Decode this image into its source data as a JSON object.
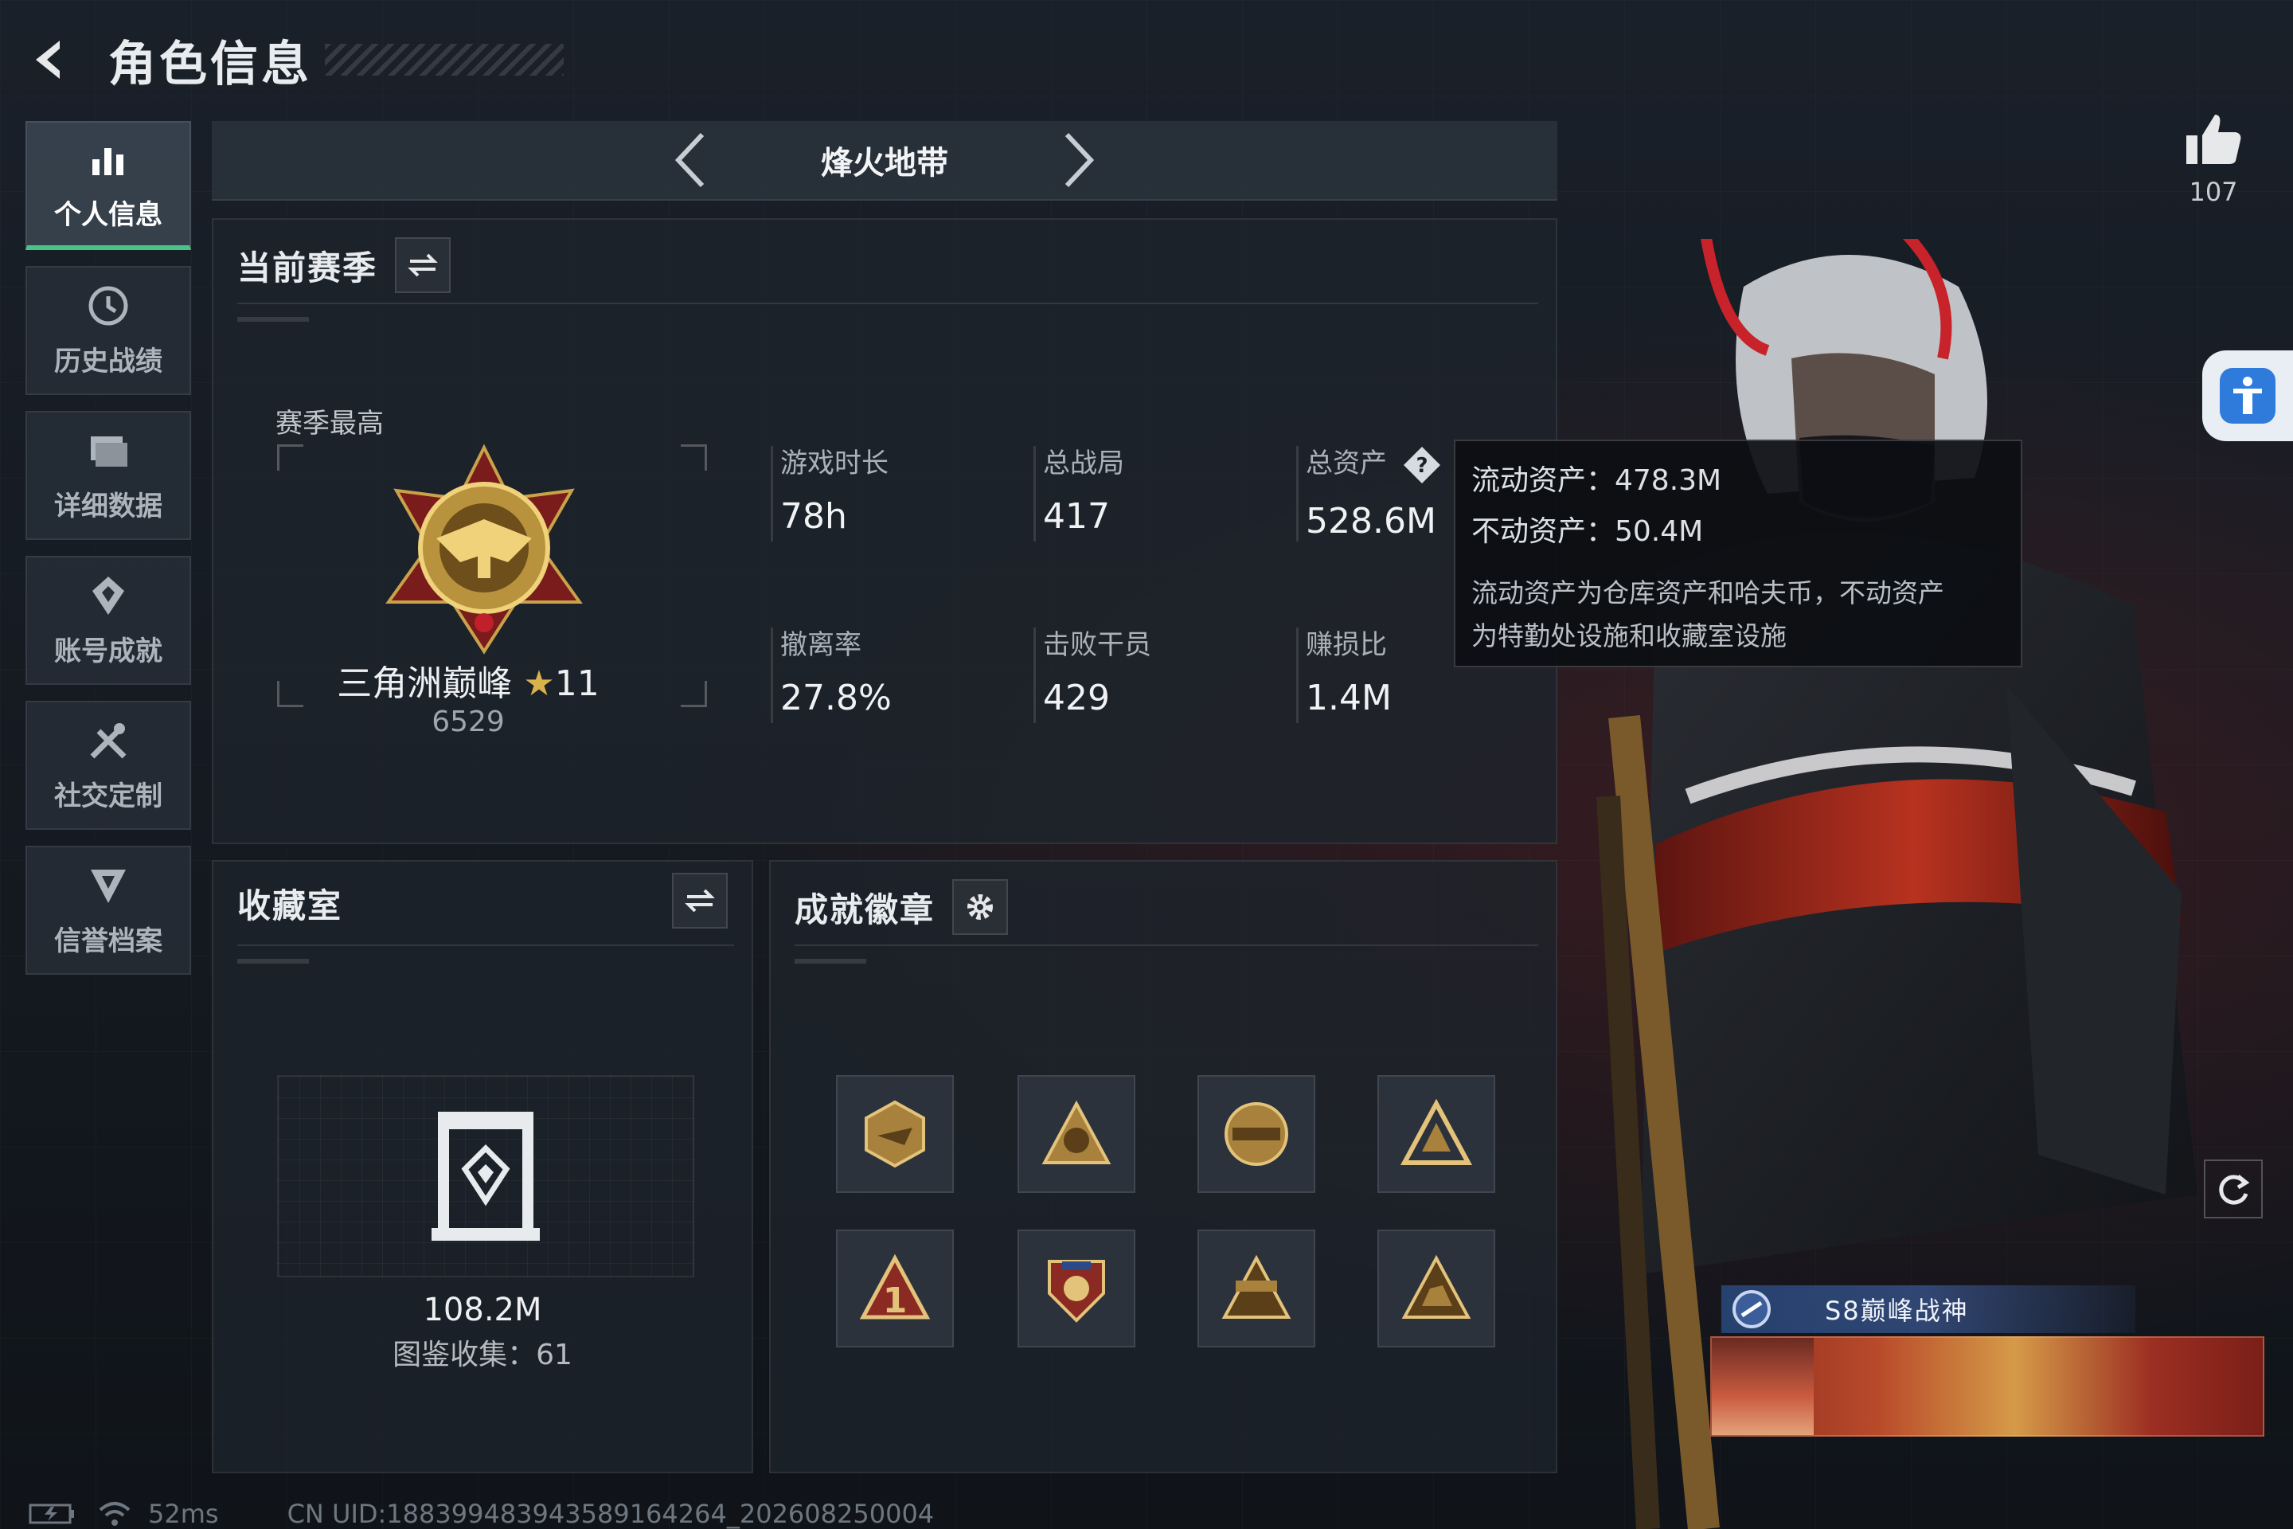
{
  "header": {
    "title": "角色信息"
  },
  "sidebar": {
    "items": [
      {
        "label": "个人信息",
        "icon": "bar-chart-icon"
      },
      {
        "label": "历史战绩",
        "icon": "history-icon"
      },
      {
        "label": "详细数据",
        "icon": "folder-icon"
      },
      {
        "label": "账号成就",
        "icon": "achievement-icon"
      },
      {
        "label": "社交定制",
        "icon": "tools-icon"
      },
      {
        "label": "信誉档案",
        "icon": "credit-icon"
      }
    ]
  },
  "mode": {
    "name": "烽火地带"
  },
  "season": {
    "title": "当前赛季",
    "rank_label": "赛季最高",
    "rank_name": "三角洲巅峰",
    "rank_stars": "11",
    "rank_score": "6529",
    "stats": [
      {
        "label": "游戏时长",
        "value": "78h"
      },
      {
        "label": "总战局",
        "value": "417"
      },
      {
        "label": "总资产",
        "value": "528.6M"
      },
      {
        "label": "撤离率",
        "value": "27.8%"
      },
      {
        "label": "击败干员",
        "value": "429"
      },
      {
        "label": "赚损比",
        "value": "1.4M"
      }
    ]
  },
  "tooltip": {
    "liquid": "流动资产：478.3M",
    "fixed": "不动资产：50.4M",
    "desc_line1": "流动资产为仓库资产和哈夫币，不动资产",
    "desc_line2": "为特勤处设施和收藏室设施"
  },
  "collection": {
    "title": "收藏室",
    "value": "108.2M",
    "count": "图鉴收集：61"
  },
  "badges": {
    "title": "成就徽章"
  },
  "likes": {
    "count": "107"
  },
  "character": {
    "title_badge": "S8巅峰战神"
  },
  "status_bar": {
    "ping": "52ms",
    "uid": "CN UID:188399483943589164264_202608250004"
  },
  "colors": {
    "accent": "#47c486",
    "gold": "#d8b24a",
    "panel": "#1e242c"
  }
}
